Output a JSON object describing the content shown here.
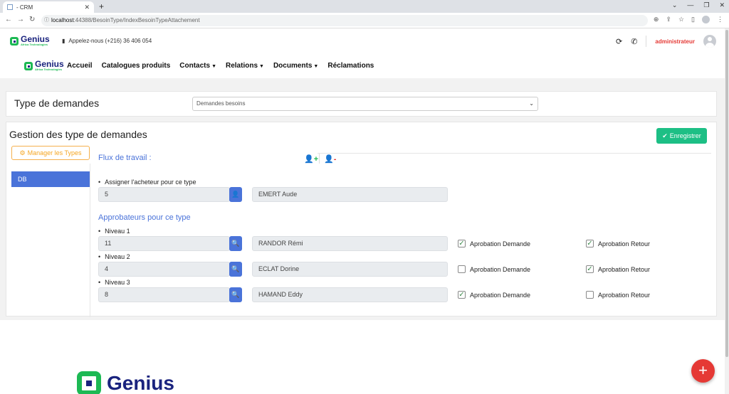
{
  "browser": {
    "tab_title": "- CRM",
    "new_tab": "+",
    "url_host": "localhost",
    "url_path": ":44388/BesoinType/IndexBesoinTypeAttachement"
  },
  "header": {
    "logo_text": "Genius",
    "logo_sub": "Africa Technologies",
    "phone": "Appelez-nous (+216) 36 406 054",
    "admin": "administrateur",
    "menu": [
      "Accueil",
      "Catalogues produits",
      "Contacts",
      "Relations",
      "Documents",
      "Réclamations"
    ],
    "menu_dropdown": [
      false,
      false,
      true,
      true,
      true,
      false
    ]
  },
  "type_card": {
    "title": "Type de demandes",
    "selected": "Demandes besoins"
  },
  "gestion": {
    "title": "Gestion des type de demandes",
    "save_label": "Enregistrer",
    "manage_label": "Manager les Types",
    "types": [
      "DB"
    ],
    "flux_title": "Flux de travail :",
    "buyer_label": "Assigner l'acheteur pour ce type",
    "buyer_id": "5",
    "buyer_name": "EMERT Aude",
    "approvers_title": "Approbateurs pour ce type",
    "levels": [
      {
        "label": "Niveau 1",
        "id": "11",
        "name": "RANDOR Rémi",
        "demande": true,
        "retour": true
      },
      {
        "label": "Niveau 2",
        "id": "4",
        "name": "ECLAT Dorine",
        "demande": false,
        "retour": true
      },
      {
        "label": "Niveau 3",
        "id": "8",
        "name": "HAMAND Eddy",
        "demande": true,
        "retour": false
      }
    ],
    "demande_label": "Aprobation Demande",
    "retour_label": "Aprobation Retour"
  },
  "footer": {
    "logo_text": "Genius",
    "fab": "+"
  },
  "colors": {
    "primary": "#4a73d9",
    "success": "#1dbf85",
    "danger": "#e53935",
    "warning": "#f5a623"
  }
}
